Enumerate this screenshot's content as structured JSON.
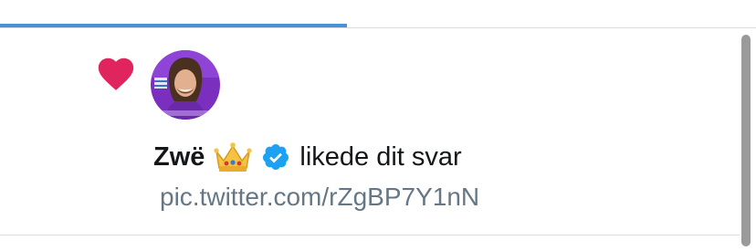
{
  "tabs": {
    "active_indicator_color": "#4a90d9"
  },
  "notification": {
    "icon": "heart-icon",
    "icon_color": "#e0245e",
    "avatar_icon": "avatar",
    "user_name": "Zwë",
    "badge_emoji": "crown-icon",
    "verified_icon": "verified-badge-icon",
    "verified_color": "#1da1f2",
    "action_text": "likede dit svar",
    "link_text": "pic.twitter.com/rZgBP7Y1nN"
  }
}
